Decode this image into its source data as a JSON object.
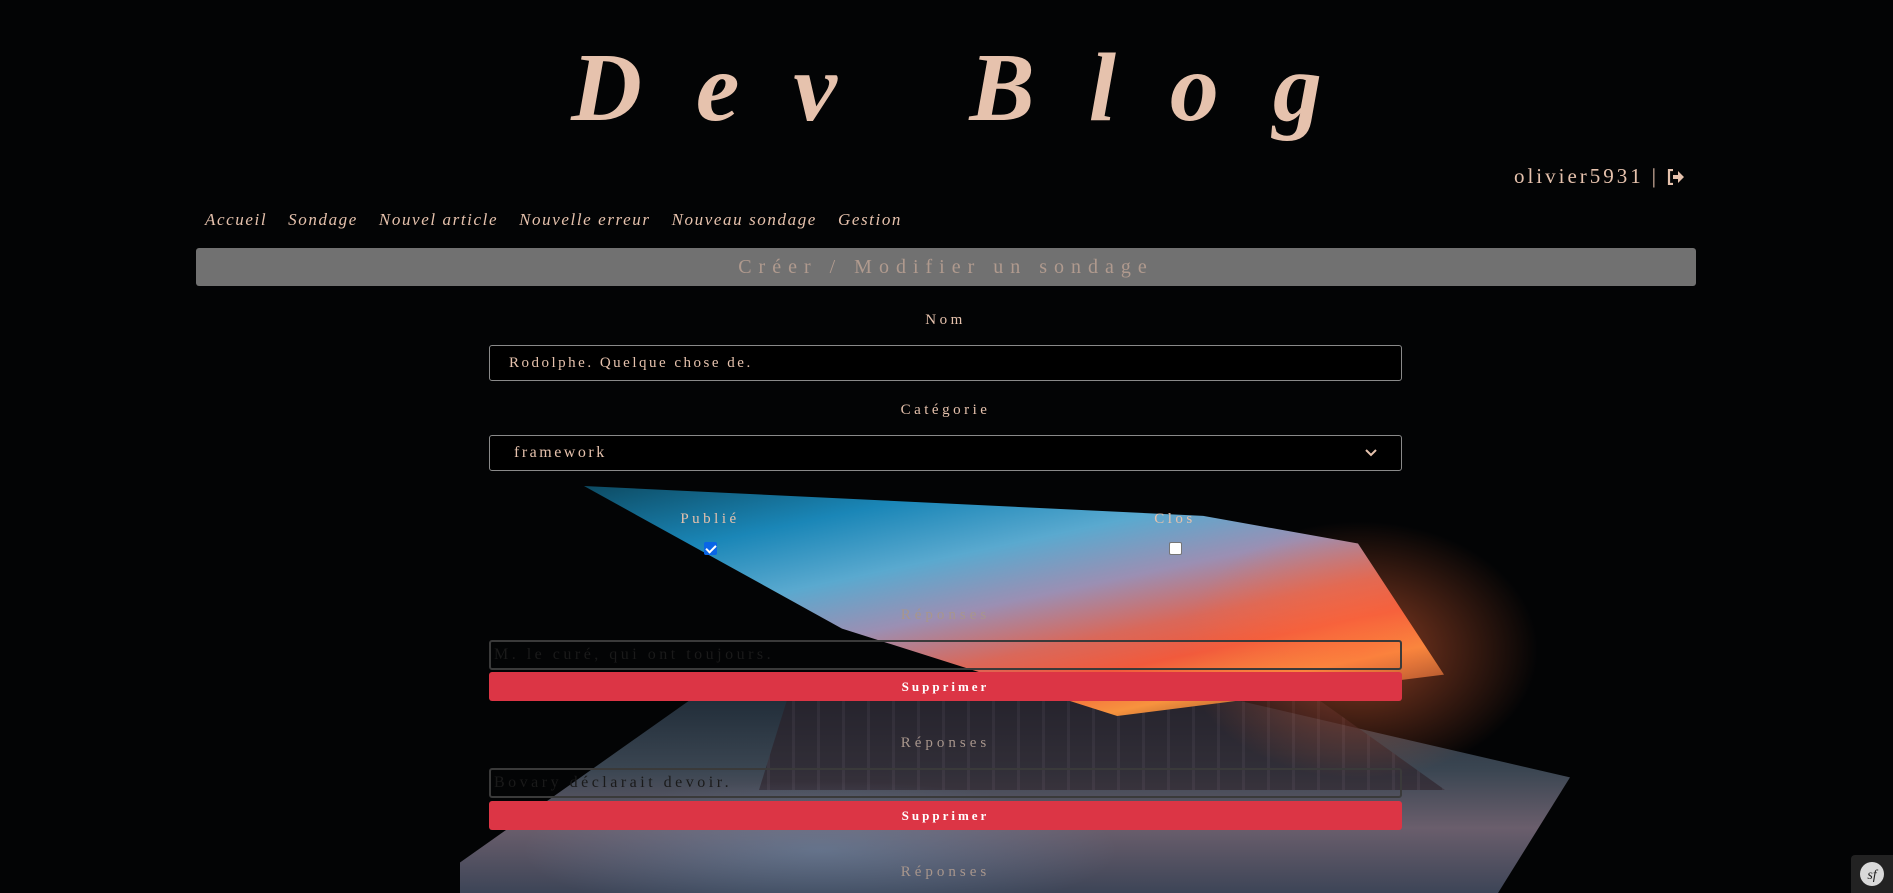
{
  "header": {
    "title": "Dev Blog",
    "username": "olivier5931",
    "separator": "|"
  },
  "nav": {
    "items": [
      "Accueil",
      "Sondage",
      "Nouvel article",
      "Nouvelle erreur",
      "Nouveau sondage",
      "Gestion"
    ]
  },
  "section": {
    "title": "Créer / Modifier un sondage"
  },
  "form": {
    "name_label": "Nom",
    "name_value": "Rodolphe. Quelque chose de.",
    "category_label": "Catégorie",
    "category_value": "framework",
    "published_label": "Publié",
    "published_checked": true,
    "closed_label": "Clos",
    "closed_checked": false,
    "responses": [
      {
        "label": "Réponses",
        "value": "M. le curé, qui ont toujours.",
        "delete_label": "Supprimer"
      },
      {
        "label": "Réponses",
        "value": "Bovary déclarait devoir.",
        "delete_label": "Supprimer"
      },
      {
        "label": "Réponses"
      }
    ]
  },
  "colors": {
    "text": "#e6c2ad",
    "header_bar": "#717171",
    "danger": "#dc3545",
    "checkbox": "#0a66e6"
  },
  "icons": {
    "logout": "sign-out-icon",
    "select": "chevron-down-icon",
    "toolbar": "symfony-icon"
  }
}
